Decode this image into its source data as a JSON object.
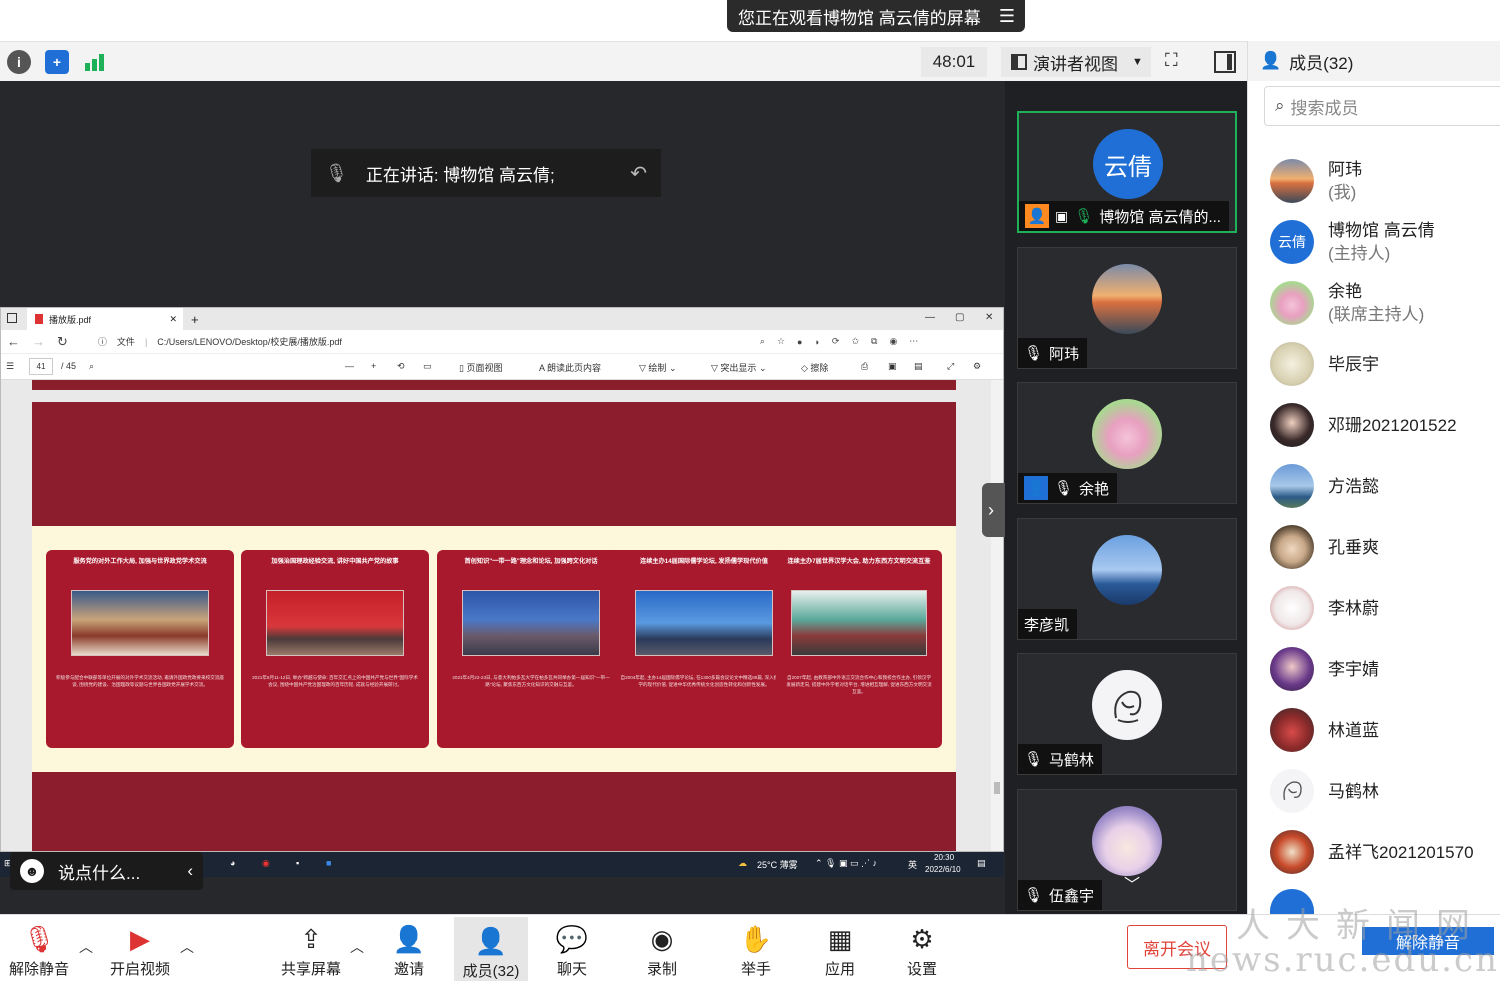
{
  "share_banner": {
    "text": "您正在观看博物馆 高云倩的屏幕",
    "menu_icon": "menu-icon"
  },
  "toolbar": {
    "timer": "48:01",
    "view_mode": "演讲者视图",
    "members_label": "成员(32)"
  },
  "speaking": {
    "text": "正在讲话: 博物馆 高云倩;"
  },
  "pdf": {
    "tab_title": "播放版.pdf",
    "address_label": "文件",
    "address_path": "C:/Users/LENOVO/Desktop/校史展/播放版.pdf",
    "page_current": "41",
    "page_total": "/ 45",
    "tools": {
      "page_view": "页面视图",
      "read_aloud": "朗读此页内容",
      "draw": "绘制",
      "highlight": "突出显示",
      "erase": "擦除"
    },
    "cards": [
      {
        "title": "服务党的对外工作大局, 加强与世界政党学术交流",
        "text": "积极参与配合中联部等单位开展的对外学术交流活动, 邀请外国政党政要来校交流座谈, 围绕党的建设、治国理政等议题与世界各国政党开展学术交流。"
      },
      {
        "title": "加强治国理政经验交流, 讲好中国共产党的故事",
        "text": "2021年6月11-12日, 举办\"跨越与使命: 百年交汇点上的中国共产党与世界\"国际学术会议, 围绕中国共产党治国理政的百年历程, 成就与经验开展研讨。"
      },
      {
        "title": "首创知识\"一带一路\"理念和论坛, 加强跨文化对话",
        "text": "2021年4月22-23日, 与意大利帕多瓦大学在帕多瓦共同举办第一届知识\"一带一路\"论坛, 聚焦东西方文化知识的交融与互鉴。"
      },
      {
        "title": "连续主办14届国际儒学论坛, 发扬儒学现代价值",
        "text": "自2004年起, 主办14届国际儒学论坛, 在1300多篇会议论文中精选89篇, 深入挖掘儒学的现代价值, 促进中华优秀传统文化创造性转化和创新性发展。"
      },
      {
        "title": "连续主办7届世界汉学大会, 助力东西方文明交流互鉴",
        "text": "自2007年起, 由教育部中外语言交流合作中心和我校合作主办, 引领汉学发展新走向, 搭建中外学者对话平台, 增进相互理解, 促进东西方文明交流互鉴。"
      }
    ]
  },
  "taskbar": {
    "weather": "25°C 薄雾",
    "ime": "英",
    "time": "20:30",
    "date": "2022/6/10"
  },
  "chat_prompt": "说点什么...",
  "video_tiles": [
    {
      "name": "博物馆 高云倩的...",
      "avatar_text": "云倩",
      "active": true
    },
    {
      "name": "阿玮",
      "avatar_text": ""
    },
    {
      "name": "余艳",
      "avatar_text": ""
    },
    {
      "name": "李彦凯",
      "avatar_text": ""
    },
    {
      "name": "马鹤林",
      "avatar_text": ""
    },
    {
      "name": "伍鑫宇",
      "avatar_text": ""
    }
  ],
  "members": {
    "search_placeholder": "搜索成员",
    "list": [
      {
        "name": "阿玮",
        "role": "(我)",
        "avatar_text": ""
      },
      {
        "name": "博物馆 高云倩",
        "role": "(主持人)",
        "avatar_text": "云倩"
      },
      {
        "name": "余艳",
        "role": "(联席主持人)",
        "avatar_text": ""
      },
      {
        "name": "毕辰宇",
        "role": "",
        "avatar_text": ""
      },
      {
        "name": "邓珊2021201522",
        "role": "",
        "avatar_text": ""
      },
      {
        "name": "方浩懿",
        "role": "",
        "avatar_text": ""
      },
      {
        "name": "孔垂爽",
        "role": "",
        "avatar_text": ""
      },
      {
        "name": "李林蔚",
        "role": "",
        "avatar_text": ""
      },
      {
        "name": "李宇婧",
        "role": "",
        "avatar_text": ""
      },
      {
        "name": "林道蓝",
        "role": "",
        "avatar_text": ""
      },
      {
        "name": "马鹤林",
        "role": "",
        "avatar_text": ""
      },
      {
        "name": "孟祥飞2021201570",
        "role": "",
        "avatar_text": ""
      }
    ]
  },
  "bottombar": {
    "unmute": "解除静音",
    "start_video": "开启视频",
    "share_screen": "共享屏幕",
    "invite": "邀请",
    "members": "成员(32)",
    "chat": "聊天",
    "record": "录制",
    "raise_hand": "举手",
    "apps": "应用",
    "settings": "设置",
    "leave": "离开会议",
    "unmute_banner": "解除静音"
  },
  "watermark": {
    "line1": "人大新闻网",
    "line2": "news.ruc.edu.cn"
  },
  "colors": {
    "accent": "#1f6fd6",
    "active_border": "#1eb157",
    "leave": "#e0443a",
    "slide_red": "#8c1d2c"
  }
}
